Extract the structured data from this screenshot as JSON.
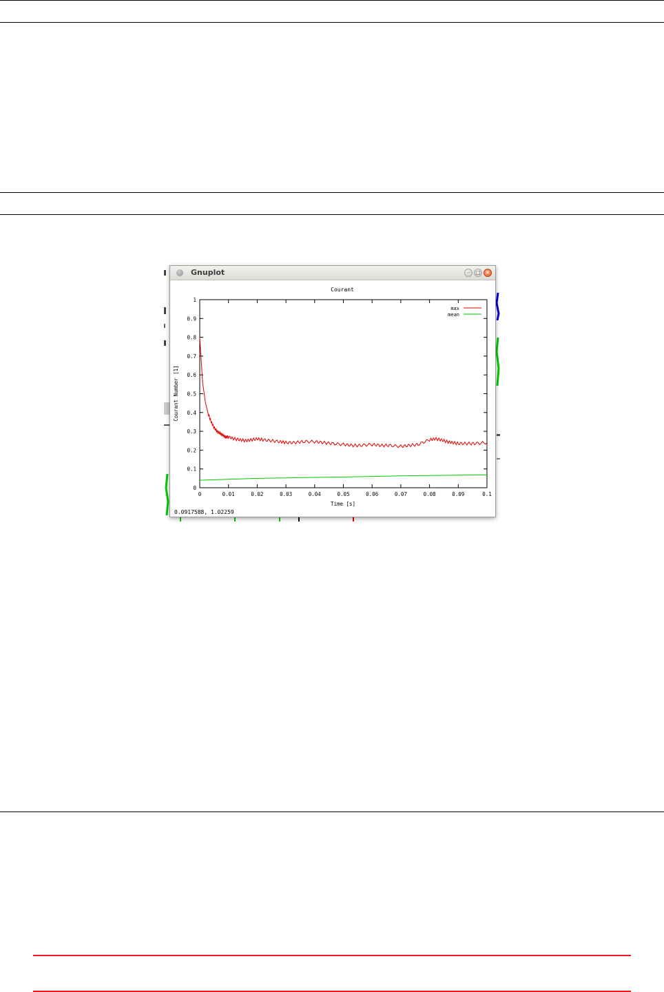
{
  "window": {
    "title": "Gnuplot",
    "status": "0.0917588,  1.02259"
  },
  "chart_data": {
    "type": "line",
    "title": "Courant",
    "xlabel": "Time [s]",
    "ylabel": "Courant Number [1]",
    "xlim": [
      0,
      0.1
    ],
    "ylim": [
      0,
      1
    ],
    "xticks": [
      "0",
      "0.01",
      "0.02",
      "0.03",
      "0.04",
      "0.05",
      "0.06",
      "0.07",
      "0.08",
      "0.09",
      "0.1"
    ],
    "yticks": [
      "0",
      "0.1",
      "0.2",
      "0.3",
      "0.4",
      "0.5",
      "0.6",
      "0.7",
      "0.8",
      "0.9",
      "1"
    ],
    "legend": "top-right",
    "grid": false,
    "series": [
      {
        "name": "max",
        "color": "#e00000",
        "x": [
          0,
          0.0005,
          0.001,
          0.002,
          0.003,
          0.004,
          0.005,
          0.006,
          0.007,
          0.008,
          0.009,
          0.01,
          0.012,
          0.014,
          0.016,
          0.018,
          0.02,
          0.022,
          0.025,
          0.028,
          0.03,
          0.033,
          0.036,
          0.04,
          0.043,
          0.046,
          0.05,
          0.053,
          0.056,
          0.06,
          0.063,
          0.066,
          0.07,
          0.073,
          0.076,
          0.08,
          0.082,
          0.084,
          0.086,
          0.088,
          0.09,
          0.093,
          0.096,
          0.1
        ],
        "y": [
          0.8,
          0.68,
          0.56,
          0.45,
          0.39,
          0.35,
          0.32,
          0.3,
          0.29,
          0.28,
          0.27,
          0.27,
          0.26,
          0.255,
          0.25,
          0.255,
          0.26,
          0.255,
          0.25,
          0.245,
          0.24,
          0.24,
          0.245,
          0.245,
          0.24,
          0.235,
          0.23,
          0.225,
          0.225,
          0.23,
          0.225,
          0.225,
          0.22,
          0.225,
          0.23,
          0.255,
          0.26,
          0.255,
          0.245,
          0.24,
          0.235,
          0.235,
          0.235,
          0.24
        ]
      },
      {
        "name": "mean",
        "color": "#00cc00",
        "x": [
          0,
          0.01,
          0.02,
          0.03,
          0.04,
          0.05,
          0.06,
          0.07,
          0.08,
          0.09,
          0.1
        ],
        "y": [
          0.04,
          0.045,
          0.05,
          0.052,
          0.055,
          0.057,
          0.06,
          0.063,
          0.065,
          0.067,
          0.068
        ]
      }
    ]
  }
}
